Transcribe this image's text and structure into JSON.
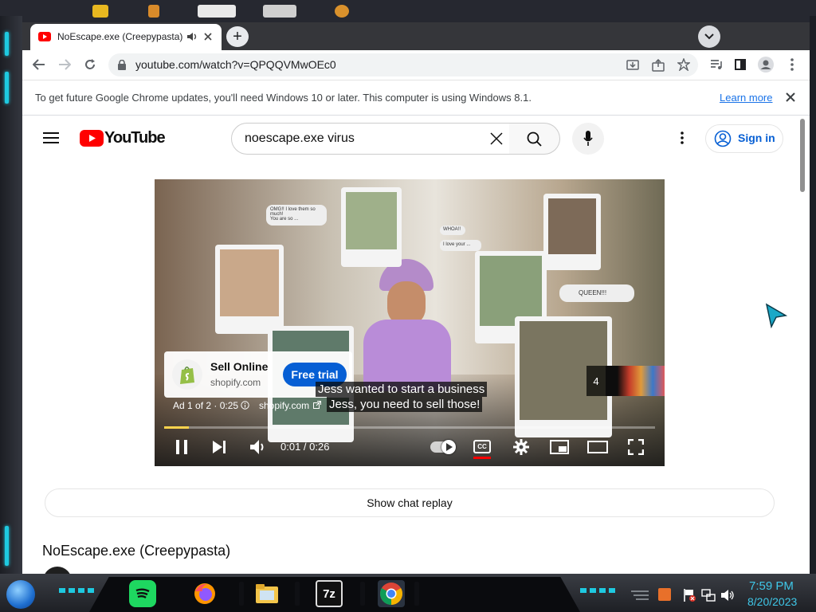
{
  "browser": {
    "tab_title": "NoEscape.exe (Creepypasta)",
    "url": "youtube.com/watch?v=QPQQVMwOEc0",
    "new_tab_symbol": "+",
    "infobar_text": "To get future Google Chrome updates, you'll need Windows 10 or later. This computer is using Windows 8.1.",
    "infobar_link": "Learn more"
  },
  "youtube": {
    "logo_text": "YouTube",
    "search_value": "noescape.exe virus",
    "signin_label": "Sign in",
    "video": {
      "ad_brand_title": "Sell Online",
      "ad_brand_domain": "shopify.com",
      "ad_cta": "Free trial",
      "ad_info": "Ad 1 of 2 · 0:25",
      "ad_link": "shopify.com",
      "caption_line1": "Jess wanted to start a business",
      "caption_line2": "Jess, you need to sell those!",
      "time": "0:01 / 0:26",
      "skip_count": "4",
      "cc_label": "CC",
      "bubble_1": "OMG!! I love them so much!",
      "bubble_2": "You are so ...",
      "bubble_3": "WHOA!!",
      "bubble_4": "I love your ...",
      "bubble_5": "QUEEN!!!",
      "progress_fraction": 0.05
    },
    "chat_replay_label": "Show chat replay",
    "video_title": "NoEscape.exe (Creepypasta)"
  },
  "taskbar": {
    "time": "7:59 PM",
    "date": "8/20/2023",
    "app_7z_label": "7z"
  },
  "colors": {
    "youtube_red": "#ff0000",
    "link_blue": "#065fd4",
    "shopify_green": "#95bf47",
    "cta_blue": "#065fd4",
    "taskbar_clock": "#3fc7e8"
  }
}
